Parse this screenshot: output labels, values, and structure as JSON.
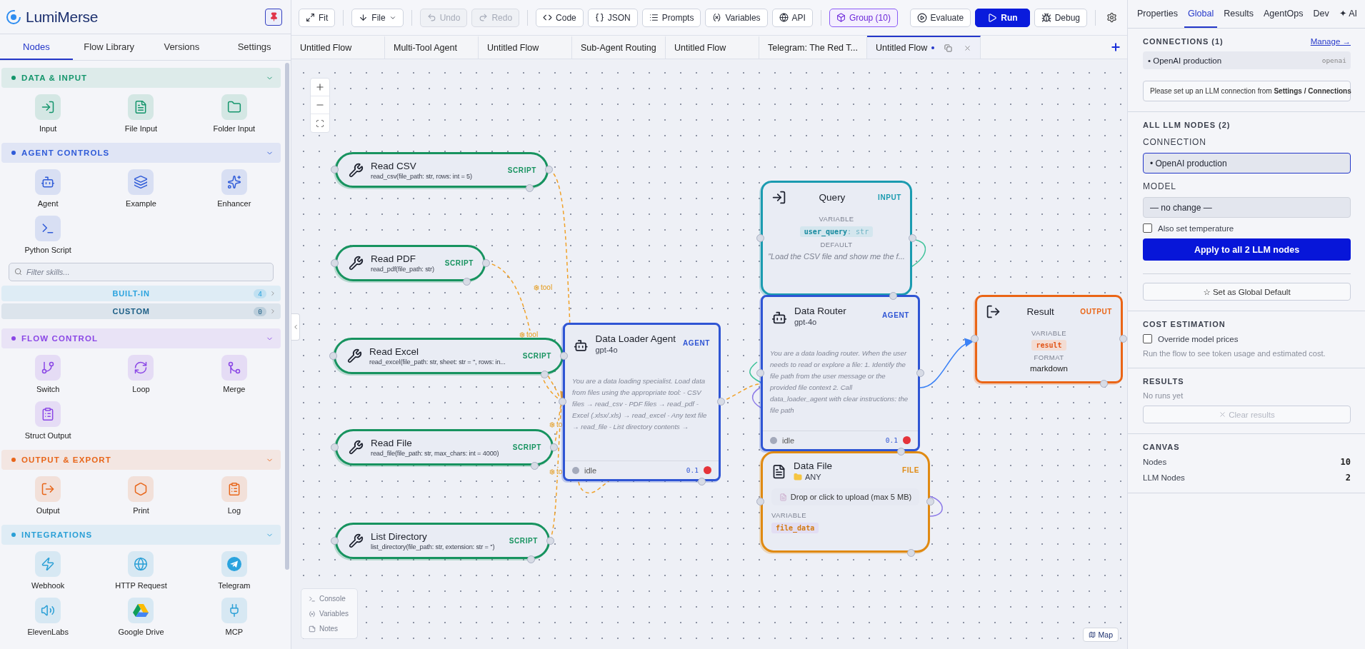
{
  "sidebar": {
    "brand": "LumiMerse",
    "tabs": [
      {
        "label": "Nodes",
        "selected": true
      },
      {
        "label": "Flow Library",
        "selected": false
      },
      {
        "label": "Versions",
        "selected": false
      },
      {
        "label": "Settings",
        "selected": false
      }
    ],
    "sections": [
      {
        "title": "DATA & INPUT",
        "color": "#13956b",
        "expanded": true,
        "items": [
          {
            "label": "Input"
          },
          {
            "label": "File Input"
          },
          {
            "label": "Folder Input"
          }
        ]
      },
      {
        "title": "AGENT CONTROLS",
        "color": "#2f5bd8",
        "expanded": true,
        "items": [
          {
            "label": "Agent"
          },
          {
            "label": "Example"
          },
          {
            "label": "Enhancer"
          },
          {
            "label": "Python Script"
          }
        ],
        "skills": {
          "placeholder": "Filter skills...",
          "groups": [
            {
              "label": "BUILT-IN",
              "count": "4",
              "color": "#2aa3de"
            },
            {
              "label": "CUSTOM",
              "count": "0",
              "color": "#1d5f86"
            }
          ]
        }
      },
      {
        "title": "FLOW CONTROL",
        "color": "#8b47e6",
        "expanded": true,
        "items": [
          {
            "label": "Switch"
          },
          {
            "label": "Loop"
          },
          {
            "label": "Merge"
          },
          {
            "label": "Struct Output"
          }
        ]
      },
      {
        "title": "OUTPUT & EXPORT",
        "color": "#e8661a",
        "expanded": true,
        "items": [
          {
            "label": "Output"
          },
          {
            "label": "Print"
          },
          {
            "label": "Log"
          }
        ]
      },
      {
        "title": "INTEGRATIONS",
        "color": "#2a9fd6",
        "expanded": true,
        "items": [
          {
            "label": "Webhook"
          },
          {
            "label": "HTTP Request"
          },
          {
            "label": "Telegram"
          },
          {
            "label": "ElevenLabs"
          },
          {
            "label": "Google Drive"
          },
          {
            "label": "MCP"
          }
        ]
      }
    ]
  },
  "toolbar": {
    "groups": [
      [
        {
          "label": "Fit",
          "kind": "plain",
          "disabled": false
        }
      ],
      [
        {
          "label": "File",
          "kind": "menu",
          "disabled": false
        }
      ],
      [
        {
          "label": "Undo",
          "kind": "plain",
          "disabled": true
        },
        {
          "label": "Redo",
          "kind": "plain",
          "disabled": true
        }
      ],
      [
        {
          "label": "Code",
          "kind": "plain",
          "disabled": false
        },
        {
          "label": "JSON",
          "kind": "plain",
          "disabled": false
        },
        {
          "label": "Prompts",
          "kind": "plain",
          "disabled": false
        },
        {
          "label": "Variables",
          "kind": "plain",
          "disabled": false
        },
        {
          "label": "API",
          "kind": "plain",
          "disabled": false
        }
      ],
      [
        {
          "label": "Group (10)",
          "kind": "accent",
          "disabled": false
        }
      ]
    ],
    "actions": [
      {
        "label": "Evaluate",
        "kind": "plain"
      },
      {
        "label": "Run",
        "kind": "primary"
      },
      {
        "label": "Debug",
        "kind": "plain"
      }
    ]
  },
  "flow_tabs": [
    {
      "label": "Untitled Flow",
      "selected": false,
      "modified": false
    },
    {
      "label": "Multi-Tool Agent",
      "selected": false,
      "modified": false
    },
    {
      "label": "Untitled Flow",
      "selected": false,
      "modified": false
    },
    {
      "label": "Sub-Agent Routing",
      "selected": false,
      "modified": false
    },
    {
      "label": "Untitled Flow",
      "selected": false,
      "modified": false
    },
    {
      "label": "Telegram: The Red T...",
      "selected": false,
      "modified": false
    },
    {
      "label": "Untitled Flow",
      "selected": true,
      "modified": true
    }
  ],
  "canvas": {
    "nodes": [
      {
        "kind": "script",
        "title": "Read CSV",
        "signature": "read_csv(file_path: str, rows: int = 5)",
        "badge": "SCRIPT"
      },
      {
        "kind": "script",
        "title": "Read PDF",
        "signature": "read_pdf(file_path: str)",
        "badge": "SCRIPT"
      },
      {
        "kind": "script",
        "title": "Read Excel",
        "signature": "read_excel(file_path: str, sheet: str = '', rows: in...",
        "badge": "SCRIPT"
      },
      {
        "kind": "script",
        "title": "Read File",
        "signature": "read_file(file_path: str, max_chars: int = 4000)",
        "badge": "SCRIPT"
      },
      {
        "kind": "script",
        "title": "List Directory",
        "signature": "list_directory(file_path: str, extension: str = '')",
        "badge": "SCRIPT"
      },
      {
        "kind": "agent",
        "title": "Data Loader Agent",
        "model": "gpt-4o",
        "badge": "AGENT",
        "prompt": "You are a data loading specialist. Load data from files using the appropriate tool: - CSV files → read_csv - PDF files → read_pdf - Excel (.xlsx/.xls) → read_excel - Any text file → read_file - List directory contents →",
        "status": "idle",
        "temperature": "0.1"
      },
      {
        "kind": "input",
        "title": "Query",
        "badge": "INPUT",
        "variable_label": "VARIABLE",
        "variable": "user_query",
        "type": ": str",
        "default_label": "DEFAULT",
        "default": "\"Load the CSV file and show me the f..."
      },
      {
        "kind": "agent",
        "title": "Data Router",
        "model": "gpt-4o",
        "badge": "AGENT",
        "prompt": "You are a data loading router. When the user needs to read or explore a file: 1. Identify the file path from the user message or the provided file context 2. Call data_loader_agent with clear instructions: the file path",
        "status": "idle",
        "temperature": "0.1"
      },
      {
        "kind": "file",
        "title": "Data File",
        "accept": "ANY",
        "badge": "FILE",
        "dropzone": "Drop or click to upload (max 5 MB)",
        "variable_label": "VARIABLE",
        "variable": "file_data"
      },
      {
        "kind": "output",
        "title": "Result",
        "badge": "OUTPUT",
        "variable_label": "VARIABLE",
        "variable": "result",
        "format_label": "FORMAT",
        "format": "markdown"
      }
    ],
    "edge_labels": [
      {
        "text": "tool"
      },
      {
        "text": "tool"
      },
      {
        "text": "to"
      },
      {
        "text": "to"
      }
    ],
    "dock": [
      {
        "label": "Console"
      },
      {
        "label": "Variables"
      },
      {
        "label": "Notes"
      }
    ],
    "map": "Map"
  },
  "right_panel": {
    "tabs": [
      {
        "label": "Properties",
        "selected": false
      },
      {
        "label": "Global",
        "selected": true
      },
      {
        "label": "Results",
        "selected": false
      },
      {
        "label": "AgentOps",
        "selected": false
      },
      {
        "label": "Dev",
        "selected": false
      },
      {
        "label": "✦ AI",
        "selected": false
      }
    ],
    "connections": {
      "title": "CONNECTIONS (1)",
      "link": "Manage →",
      "items": [
        {
          "name": "• OpenAI production",
          "provider": "openai"
        }
      ],
      "note": "Please set up an LLM connection from **Settings / Connections**"
    },
    "llm_nodes": {
      "title": "ALL LLM NODES (2)",
      "connection_label": "CONNECTION",
      "connection": "• OpenAI production",
      "connection_focused": true,
      "model_label": "MODEL",
      "model": "— no change —",
      "temperature": {
        "label": "Also set temperature",
        "checked": false
      },
      "apply": "Apply to all 2 LLM nodes",
      "default_button": "☆ Set as Global Default"
    },
    "cost": {
      "title": "COST ESTIMATION",
      "override": {
        "label": "Override model prices",
        "checked": false
      },
      "note": "Run the flow to see token usage and estimated cost."
    },
    "results": {
      "title": "RESULTS",
      "empty": "No runs yet",
      "clear": {
        "label": "Clear results",
        "disabled": true
      }
    },
    "canvas_stats": {
      "title": "CANVAS",
      "rows": [
        {
          "label": "Nodes",
          "value": "10"
        },
        {
          "label": "LLM Nodes",
          "value": "2"
        }
      ]
    }
  }
}
